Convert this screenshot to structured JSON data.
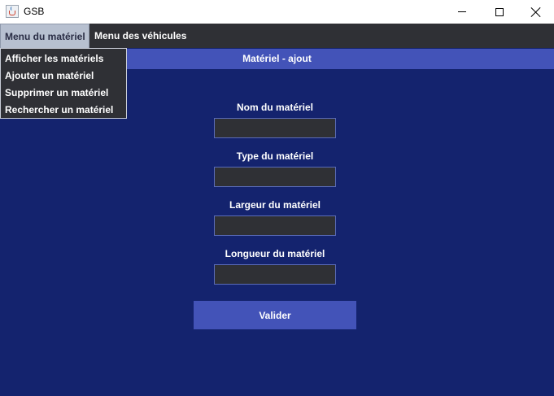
{
  "window": {
    "title": "GSB",
    "icon": "java-cup-icon"
  },
  "menubar": {
    "items": [
      {
        "label": "Menu du matériel",
        "open": true
      },
      {
        "label": "Menu des véhicules",
        "open": false
      }
    ]
  },
  "dropdown": {
    "items": [
      {
        "label": "Afficher les matériels"
      },
      {
        "label": "Ajouter un matériel"
      },
      {
        "label": "Supprimer un matériel"
      },
      {
        "label": "Rechercher un matériel"
      }
    ]
  },
  "header": {
    "title": "Matériel - ajout"
  },
  "form": {
    "fields": [
      {
        "label": "Nom du matériel",
        "value": ""
      },
      {
        "label": "Type du matériel",
        "value": ""
      },
      {
        "label": "Largeur du matériel",
        "value": ""
      },
      {
        "label": "Longueur du matériel",
        "value": ""
      }
    ],
    "submit_label": "Valider"
  },
  "colors": {
    "background": "#14236e",
    "accent": "#4353b8",
    "menubar": "#2f3035",
    "input_bg": "#2f3035"
  }
}
